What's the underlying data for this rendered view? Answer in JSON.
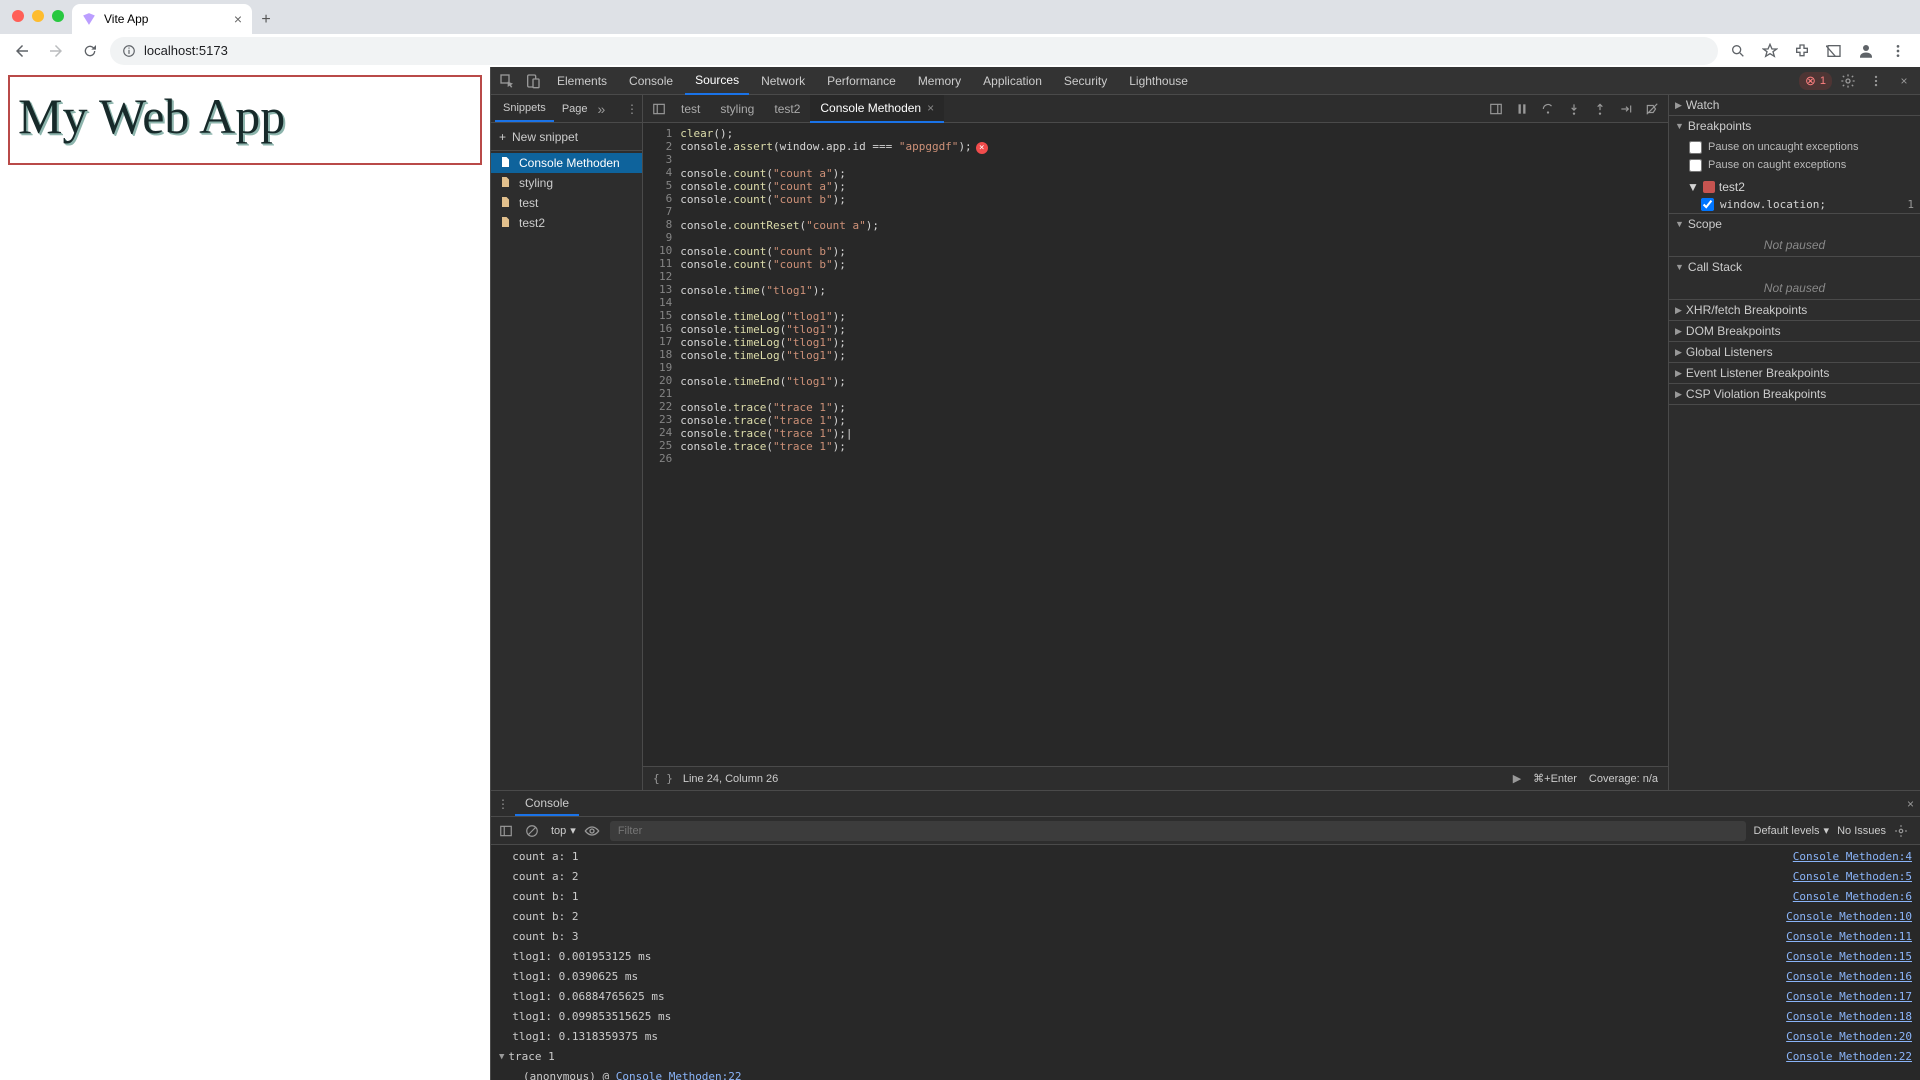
{
  "browser": {
    "tab_title": "Vite App",
    "url": "localhost:5173"
  },
  "page": {
    "heading": "My Web App"
  },
  "devtools": {
    "main_tabs": [
      "Elements",
      "Console",
      "Sources",
      "Network",
      "Performance",
      "Memory",
      "Application",
      "Security",
      "Lighthouse"
    ],
    "active_main_tab": "Sources",
    "error_count": "1",
    "snippets": {
      "tabs": [
        "Snippets",
        "Page"
      ],
      "active_tab": "Snippets",
      "new_label": "New snippet",
      "items": [
        "Console Methoden",
        "styling",
        "test",
        "test2"
      ],
      "selected": "Console Methoden"
    },
    "editor": {
      "open_tabs": [
        "test",
        "styling",
        "test2",
        "Console Methoden"
      ],
      "active_tab": "Console Methoden",
      "status_line": "Line 24, Column 26",
      "run_hint": "⌘+Enter",
      "coverage": "Coverage: n/a",
      "code": [
        {
          "n": 1,
          "parts": [
            {
              "t": "clear",
              "c": "fn"
            },
            {
              "t": "();"
            }
          ]
        },
        {
          "n": 2,
          "parts": [
            {
              "t": "console."
            },
            {
              "t": "assert",
              "c": "fn"
            },
            {
              "t": "(window.app.id "
            },
            {
              "t": "===",
              "c": "op"
            },
            {
              "t": " "
            },
            {
              "t": "\"appggdf\"",
              "c": "str"
            },
            {
              "t": ");"
            }
          ],
          "err": true
        },
        {
          "n": 3,
          "parts": []
        },
        {
          "n": 4,
          "parts": [
            {
              "t": "console."
            },
            {
              "t": "count",
              "c": "fn"
            },
            {
              "t": "("
            },
            {
              "t": "\"count a\"",
              "c": "str"
            },
            {
              "t": ");"
            }
          ]
        },
        {
          "n": 5,
          "parts": [
            {
              "t": "console."
            },
            {
              "t": "count",
              "c": "fn"
            },
            {
              "t": "("
            },
            {
              "t": "\"count a\"",
              "c": "str"
            },
            {
              "t": ");"
            }
          ]
        },
        {
          "n": 6,
          "parts": [
            {
              "t": "console."
            },
            {
              "t": "count",
              "c": "fn"
            },
            {
              "t": "("
            },
            {
              "t": "\"count b\"",
              "c": "str"
            },
            {
              "t": ");"
            }
          ]
        },
        {
          "n": 7,
          "parts": []
        },
        {
          "n": 8,
          "parts": [
            {
              "t": "console."
            },
            {
              "t": "countReset",
              "c": "fn"
            },
            {
              "t": "("
            },
            {
              "t": "\"count a\"",
              "c": "str"
            },
            {
              "t": ");"
            }
          ]
        },
        {
          "n": 9,
          "parts": []
        },
        {
          "n": 10,
          "parts": [
            {
              "t": "console."
            },
            {
              "t": "count",
              "c": "fn"
            },
            {
              "t": "("
            },
            {
              "t": "\"count b\"",
              "c": "str"
            },
            {
              "t": ");"
            }
          ]
        },
        {
          "n": 11,
          "parts": [
            {
              "t": "console."
            },
            {
              "t": "count",
              "c": "fn"
            },
            {
              "t": "("
            },
            {
              "t": "\"count b\"",
              "c": "str"
            },
            {
              "t": ");"
            }
          ]
        },
        {
          "n": 12,
          "parts": []
        },
        {
          "n": 13,
          "parts": [
            {
              "t": "console."
            },
            {
              "t": "time",
              "c": "fn"
            },
            {
              "t": "("
            },
            {
              "t": "\"tlog1\"",
              "c": "str"
            },
            {
              "t": ");"
            }
          ]
        },
        {
          "n": 14,
          "parts": []
        },
        {
          "n": 15,
          "parts": [
            {
              "t": "console."
            },
            {
              "t": "timeLog",
              "c": "fn"
            },
            {
              "t": "("
            },
            {
              "t": "\"tlog1\"",
              "c": "str"
            },
            {
              "t": ");"
            }
          ]
        },
        {
          "n": 16,
          "parts": [
            {
              "t": "console."
            },
            {
              "t": "timeLog",
              "c": "fn"
            },
            {
              "t": "("
            },
            {
              "t": "\"tlog1\"",
              "c": "str"
            },
            {
              "t": ");"
            }
          ]
        },
        {
          "n": 17,
          "parts": [
            {
              "t": "console."
            },
            {
              "t": "timeLog",
              "c": "fn"
            },
            {
              "t": "("
            },
            {
              "t": "\"tlog1\"",
              "c": "str"
            },
            {
              "t": ");"
            }
          ]
        },
        {
          "n": 18,
          "parts": [
            {
              "t": "console."
            },
            {
              "t": "timeLog",
              "c": "fn"
            },
            {
              "t": "("
            },
            {
              "t": "\"tlog1\"",
              "c": "str"
            },
            {
              "t": ");"
            }
          ]
        },
        {
          "n": 19,
          "parts": []
        },
        {
          "n": 20,
          "parts": [
            {
              "t": "console."
            },
            {
              "t": "timeEnd",
              "c": "fn"
            },
            {
              "t": "("
            },
            {
              "t": "\"tlog1\"",
              "c": "str"
            },
            {
              "t": ");"
            }
          ]
        },
        {
          "n": 21,
          "parts": []
        },
        {
          "n": 22,
          "parts": [
            {
              "t": "console."
            },
            {
              "t": "trace",
              "c": "fn"
            },
            {
              "t": "("
            },
            {
              "t": "\"trace 1\"",
              "c": "str"
            },
            {
              "t": ");"
            }
          ]
        },
        {
          "n": 23,
          "parts": [
            {
              "t": "console."
            },
            {
              "t": "trace",
              "c": "fn"
            },
            {
              "t": "("
            },
            {
              "t": "\"trace 1\"",
              "c": "str"
            },
            {
              "t": ");"
            }
          ]
        },
        {
          "n": 24,
          "parts": [
            {
              "t": "console."
            },
            {
              "t": "trace",
              "c": "fn"
            },
            {
              "t": "("
            },
            {
              "t": "\"trace 1\"",
              "c": "str"
            },
            {
              "t": ");|"
            }
          ]
        },
        {
          "n": 25,
          "parts": [
            {
              "t": "console."
            },
            {
              "t": "trace",
              "c": "fn"
            },
            {
              "t": "("
            },
            {
              "t": "\"trace 1\"",
              "c": "str"
            },
            {
              "t": ");"
            }
          ]
        },
        {
          "n": 26,
          "parts": []
        }
      ]
    },
    "debug": {
      "watch_label": "Watch",
      "breakpoints_label": "Breakpoints",
      "pause_uncaught": "Pause on uncaught exceptions",
      "pause_caught": "Pause on caught exceptions",
      "bp_file": "test2",
      "bp_entry": "window.location;",
      "bp_entry_line": "1",
      "scope_label": "Scope",
      "callstack_label": "Call Stack",
      "not_paused": "Not paused",
      "sections": [
        "XHR/fetch Breakpoints",
        "DOM Breakpoints",
        "Global Listeners",
        "Event Listener Breakpoints",
        "CSP Violation Breakpoints"
      ]
    },
    "console": {
      "tab_label": "Console",
      "context": "top",
      "filter_placeholder": "Filter",
      "levels": "Default levels",
      "issues": "No Issues",
      "rows": [
        {
          "msg": "count a: 1",
          "src": "Console Methoden:4"
        },
        {
          "msg": "count a: 2",
          "src": "Console Methoden:5"
        },
        {
          "msg": "count b: 1",
          "src": "Console Methoden:6"
        },
        {
          "msg": "count b: 2",
          "src": "Console Methoden:10"
        },
        {
          "msg": "count b: 3",
          "src": "Console Methoden:11"
        },
        {
          "msg": "tlog1: 0.001953125 ms",
          "src": "Console Methoden:15"
        },
        {
          "msg": "tlog1: 0.0390625 ms",
          "src": "Console Methoden:16"
        },
        {
          "msg": "tlog1: 0.06884765625 ms",
          "src": "Console Methoden:17"
        },
        {
          "msg": "tlog1: 0.099853515625 ms",
          "src": "Console Methoden:18"
        },
        {
          "msg": "tlog1: 0.1318359375 ms",
          "src": "Console Methoden:20"
        }
      ],
      "trace": {
        "label": "trace 1",
        "src": "Console Methoden:22",
        "anon": "(anonymous)",
        "anon_src": "Console Methoden:22"
      }
    }
  }
}
